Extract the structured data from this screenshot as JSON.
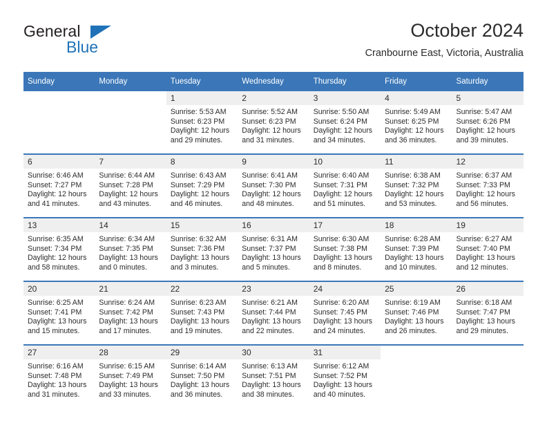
{
  "brand": {
    "name_part1": "General",
    "name_part2": "Blue",
    "triangle_icon": "triangle-icon",
    "accent_color": "#1f72b8"
  },
  "header": {
    "title": "October 2024",
    "subtitle": "Cranbourne East, Victoria, Australia"
  },
  "theme": {
    "header_blue": "#3b77b8",
    "daynum_gray": "#efefef",
    "text": "#2b2b2b"
  },
  "calendar": {
    "weekday_headers": [
      "Sunday",
      "Monday",
      "Tuesday",
      "Wednesday",
      "Thursday",
      "Friday",
      "Saturday"
    ],
    "weeks": [
      [
        {
          "day": "",
          "blank": true
        },
        {
          "day": "",
          "blank": true
        },
        {
          "day": "1",
          "sunrise": "Sunrise: 5:53 AM",
          "sunset": "Sunset: 6:23 PM",
          "daylight1": "Daylight: 12 hours",
          "daylight2": "and 29 minutes."
        },
        {
          "day": "2",
          "sunrise": "Sunrise: 5:52 AM",
          "sunset": "Sunset: 6:23 PM",
          "daylight1": "Daylight: 12 hours",
          "daylight2": "and 31 minutes."
        },
        {
          "day": "3",
          "sunrise": "Sunrise: 5:50 AM",
          "sunset": "Sunset: 6:24 PM",
          "daylight1": "Daylight: 12 hours",
          "daylight2": "and 34 minutes."
        },
        {
          "day": "4",
          "sunrise": "Sunrise: 5:49 AM",
          "sunset": "Sunset: 6:25 PM",
          "daylight1": "Daylight: 12 hours",
          "daylight2": "and 36 minutes."
        },
        {
          "day": "5",
          "sunrise": "Sunrise: 5:47 AM",
          "sunset": "Sunset: 6:26 PM",
          "daylight1": "Daylight: 12 hours",
          "daylight2": "and 39 minutes."
        }
      ],
      [
        {
          "day": "6",
          "sunrise": "Sunrise: 6:46 AM",
          "sunset": "Sunset: 7:27 PM",
          "daylight1": "Daylight: 12 hours",
          "daylight2": "and 41 minutes."
        },
        {
          "day": "7",
          "sunrise": "Sunrise: 6:44 AM",
          "sunset": "Sunset: 7:28 PM",
          "daylight1": "Daylight: 12 hours",
          "daylight2": "and 43 minutes."
        },
        {
          "day": "8",
          "sunrise": "Sunrise: 6:43 AM",
          "sunset": "Sunset: 7:29 PM",
          "daylight1": "Daylight: 12 hours",
          "daylight2": "and 46 minutes."
        },
        {
          "day": "9",
          "sunrise": "Sunrise: 6:41 AM",
          "sunset": "Sunset: 7:30 PM",
          "daylight1": "Daylight: 12 hours",
          "daylight2": "and 48 minutes."
        },
        {
          "day": "10",
          "sunrise": "Sunrise: 6:40 AM",
          "sunset": "Sunset: 7:31 PM",
          "daylight1": "Daylight: 12 hours",
          "daylight2": "and 51 minutes."
        },
        {
          "day": "11",
          "sunrise": "Sunrise: 6:38 AM",
          "sunset": "Sunset: 7:32 PM",
          "daylight1": "Daylight: 12 hours",
          "daylight2": "and 53 minutes."
        },
        {
          "day": "12",
          "sunrise": "Sunrise: 6:37 AM",
          "sunset": "Sunset: 7:33 PM",
          "daylight1": "Daylight: 12 hours",
          "daylight2": "and 56 minutes."
        }
      ],
      [
        {
          "day": "13",
          "sunrise": "Sunrise: 6:35 AM",
          "sunset": "Sunset: 7:34 PM",
          "daylight1": "Daylight: 12 hours",
          "daylight2": "and 58 minutes."
        },
        {
          "day": "14",
          "sunrise": "Sunrise: 6:34 AM",
          "sunset": "Sunset: 7:35 PM",
          "daylight1": "Daylight: 13 hours",
          "daylight2": "and 0 minutes."
        },
        {
          "day": "15",
          "sunrise": "Sunrise: 6:32 AM",
          "sunset": "Sunset: 7:36 PM",
          "daylight1": "Daylight: 13 hours",
          "daylight2": "and 3 minutes."
        },
        {
          "day": "16",
          "sunrise": "Sunrise: 6:31 AM",
          "sunset": "Sunset: 7:37 PM",
          "daylight1": "Daylight: 13 hours",
          "daylight2": "and 5 minutes."
        },
        {
          "day": "17",
          "sunrise": "Sunrise: 6:30 AM",
          "sunset": "Sunset: 7:38 PM",
          "daylight1": "Daylight: 13 hours",
          "daylight2": "and 8 minutes."
        },
        {
          "day": "18",
          "sunrise": "Sunrise: 6:28 AM",
          "sunset": "Sunset: 7:39 PM",
          "daylight1": "Daylight: 13 hours",
          "daylight2": "and 10 minutes."
        },
        {
          "day": "19",
          "sunrise": "Sunrise: 6:27 AM",
          "sunset": "Sunset: 7:40 PM",
          "daylight1": "Daylight: 13 hours",
          "daylight2": "and 12 minutes."
        }
      ],
      [
        {
          "day": "20",
          "sunrise": "Sunrise: 6:25 AM",
          "sunset": "Sunset: 7:41 PM",
          "daylight1": "Daylight: 13 hours",
          "daylight2": "and 15 minutes."
        },
        {
          "day": "21",
          "sunrise": "Sunrise: 6:24 AM",
          "sunset": "Sunset: 7:42 PM",
          "daylight1": "Daylight: 13 hours",
          "daylight2": "and 17 minutes."
        },
        {
          "day": "22",
          "sunrise": "Sunrise: 6:23 AM",
          "sunset": "Sunset: 7:43 PM",
          "daylight1": "Daylight: 13 hours",
          "daylight2": "and 19 minutes."
        },
        {
          "day": "23",
          "sunrise": "Sunrise: 6:21 AM",
          "sunset": "Sunset: 7:44 PM",
          "daylight1": "Daylight: 13 hours",
          "daylight2": "and 22 minutes."
        },
        {
          "day": "24",
          "sunrise": "Sunrise: 6:20 AM",
          "sunset": "Sunset: 7:45 PM",
          "daylight1": "Daylight: 13 hours",
          "daylight2": "and 24 minutes."
        },
        {
          "day": "25",
          "sunrise": "Sunrise: 6:19 AM",
          "sunset": "Sunset: 7:46 PM",
          "daylight1": "Daylight: 13 hours",
          "daylight2": "and 26 minutes."
        },
        {
          "day": "26",
          "sunrise": "Sunrise: 6:18 AM",
          "sunset": "Sunset: 7:47 PM",
          "daylight1": "Daylight: 13 hours",
          "daylight2": "and 29 minutes."
        }
      ],
      [
        {
          "day": "27",
          "sunrise": "Sunrise: 6:16 AM",
          "sunset": "Sunset: 7:48 PM",
          "daylight1": "Daylight: 13 hours",
          "daylight2": "and 31 minutes."
        },
        {
          "day": "28",
          "sunrise": "Sunrise: 6:15 AM",
          "sunset": "Sunset: 7:49 PM",
          "daylight1": "Daylight: 13 hours",
          "daylight2": "and 33 minutes."
        },
        {
          "day": "29",
          "sunrise": "Sunrise: 6:14 AM",
          "sunset": "Sunset: 7:50 PM",
          "daylight1": "Daylight: 13 hours",
          "daylight2": "and 36 minutes."
        },
        {
          "day": "30",
          "sunrise": "Sunrise: 6:13 AM",
          "sunset": "Sunset: 7:51 PM",
          "daylight1": "Daylight: 13 hours",
          "daylight2": "and 38 minutes."
        },
        {
          "day": "31",
          "sunrise": "Sunrise: 6:12 AM",
          "sunset": "Sunset: 7:52 PM",
          "daylight1": "Daylight: 13 hours",
          "daylight2": "and 40 minutes."
        },
        {
          "day": "",
          "blank": true
        },
        {
          "day": "",
          "blank": true
        }
      ]
    ]
  }
}
